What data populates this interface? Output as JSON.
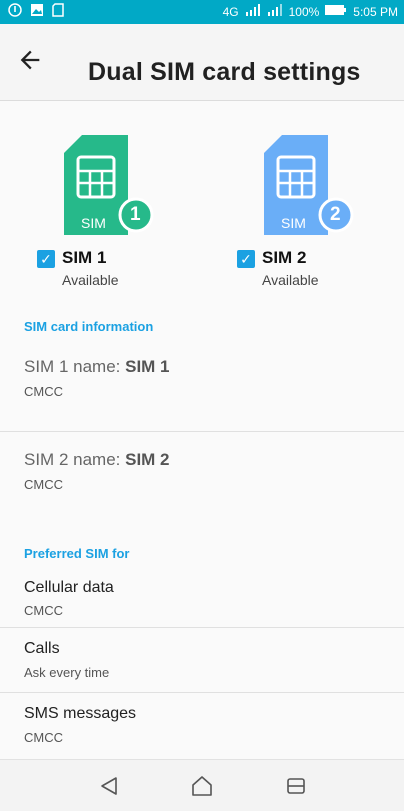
{
  "status_bar": {
    "network": "4G",
    "battery": "100%",
    "time": "5:05 PM"
  },
  "header": {
    "title": "Dual SIM card settings"
  },
  "sims": [
    {
      "name": "SIM 1",
      "status": "Available",
      "badge": "1",
      "card_label": "SIM",
      "color": "#26b98a",
      "checked": true
    },
    {
      "name": "SIM 2",
      "status": "Available",
      "badge": "2",
      "card_label": "SIM",
      "color": "#6aaef7",
      "checked": true
    }
  ],
  "sim_info": {
    "header": "SIM card information",
    "rows": [
      {
        "label": "SIM 1 name: ",
        "value": "SIM 1",
        "carrier": "CMCC"
      },
      {
        "label": "SIM 2 name: ",
        "value": "SIM 2",
        "carrier": "CMCC"
      }
    ]
  },
  "preferred": {
    "header": "Preferred SIM for",
    "items": [
      {
        "title": "Cellular data",
        "value": "CMCC"
      },
      {
        "title": "Calls",
        "value": "Ask every time"
      },
      {
        "title": "SMS messages",
        "value": "CMCC"
      }
    ]
  },
  "colors": {
    "status_bar": "#01a9c6",
    "accent": "#1ba1e2",
    "sim1": "#26b98a",
    "sim2": "#6aaef7"
  }
}
